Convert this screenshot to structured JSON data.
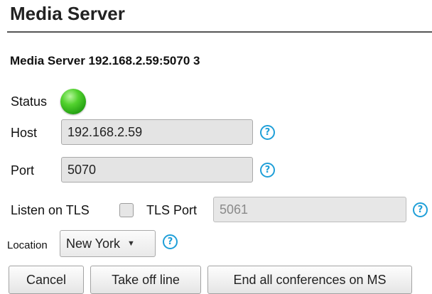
{
  "page": {
    "title": "Media Server",
    "subtitle": "Media Server 192.168.2.59:5070 3"
  },
  "status": {
    "label": "Status",
    "indicator": "online",
    "color": "#2bb515"
  },
  "host": {
    "label": "Host",
    "value": "192.168.2.59",
    "help_icon": "help-circle-icon"
  },
  "port": {
    "label": "Port",
    "value": "5070",
    "help_icon": "help-circle-icon"
  },
  "tls": {
    "listen_label": "Listen on TLS",
    "listen_checked": false,
    "port_label": "TLS Port",
    "port_value": "5061",
    "help_icon": "help-circle-icon"
  },
  "location": {
    "label": "Location",
    "selected": "New York",
    "help_icon": "help-circle-icon"
  },
  "buttons": {
    "cancel": "Cancel",
    "take_offline": "Take off line",
    "end_conferences": "End all conferences on MS"
  },
  "colors": {
    "accent": "#1f9fd8",
    "status_green": "#2bb515"
  }
}
